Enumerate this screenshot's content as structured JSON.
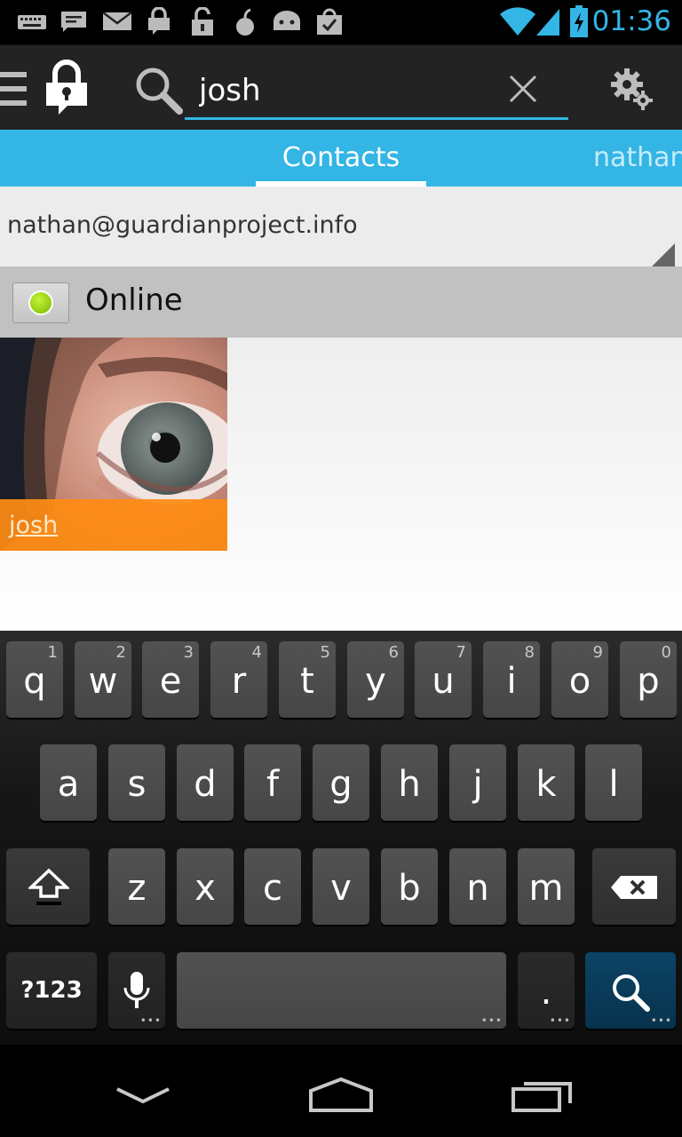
{
  "status_bar": {
    "time": "01:36",
    "accent_color": "#33b5e5",
    "notification_icons": [
      "keyboard-icon",
      "message-icon",
      "mail-icon",
      "lock-chat-icon",
      "unlock-icon",
      "bomb-icon",
      "android-icon",
      "bag-check-icon"
    ],
    "system_icons": [
      "wifi-icon",
      "signal-icon",
      "battery-charging-icon"
    ]
  },
  "action_bar": {
    "menu_icon": "menu-icon",
    "app_icon": "chat-lock-icon",
    "search_icon": "search-icon",
    "search_value": "josh",
    "clear_icon": "close-icon",
    "settings_icon": "gear-icon"
  },
  "tabs": {
    "items": [
      {
        "label": "Contacts",
        "selected": true
      },
      {
        "label": "nathan",
        "selected": false
      }
    ],
    "color": "#33b5e5"
  },
  "account": {
    "selected": "nathan@guardianproject.info"
  },
  "presence": {
    "label": "Online",
    "status_color": "#8cc800"
  },
  "contacts": [
    {
      "name": "josh",
      "name_bar_color": "#ff8c14"
    }
  ],
  "keyboard": {
    "row1": [
      {
        "key": "q",
        "hint": "1"
      },
      {
        "key": "w",
        "hint": "2"
      },
      {
        "key": "e",
        "hint": "3"
      },
      {
        "key": "r",
        "hint": "4"
      },
      {
        "key": "t",
        "hint": "5"
      },
      {
        "key": "y",
        "hint": "6"
      },
      {
        "key": "u",
        "hint": "7"
      },
      {
        "key": "i",
        "hint": "8"
      },
      {
        "key": "o",
        "hint": "9"
      },
      {
        "key": "p",
        "hint": "0"
      }
    ],
    "row2": [
      "a",
      "s",
      "d",
      "f",
      "g",
      "h",
      "j",
      "k",
      "l"
    ],
    "row3": [
      "z",
      "x",
      "c",
      "v",
      "b",
      "n",
      "m"
    ],
    "symbols_label": "?123",
    "period_label": ".",
    "shift_icon": "shift-icon",
    "delete_icon": "backspace-icon",
    "mic_icon": "mic-icon",
    "search_key_icon": "search-icon",
    "search_key_color": "#0a3a57"
  },
  "nav_bar": {
    "back_icon": "back-chevron-icon",
    "home_icon": "home-icon",
    "recents_icon": "recents-icon"
  }
}
